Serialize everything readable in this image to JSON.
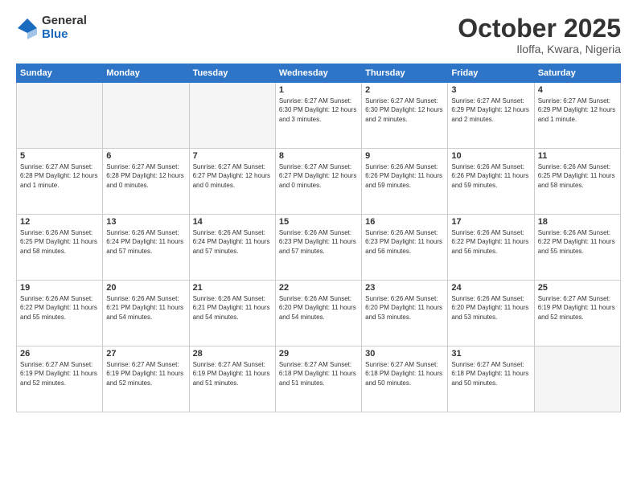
{
  "logo": {
    "general": "General",
    "blue": "Blue"
  },
  "header": {
    "month": "October 2025",
    "location": "Iloffa, Kwara, Nigeria"
  },
  "days_of_week": [
    "Sunday",
    "Monday",
    "Tuesday",
    "Wednesday",
    "Thursday",
    "Friday",
    "Saturday"
  ],
  "weeks": [
    [
      {
        "day": "",
        "info": ""
      },
      {
        "day": "",
        "info": ""
      },
      {
        "day": "",
        "info": ""
      },
      {
        "day": "1",
        "info": "Sunrise: 6:27 AM\nSunset: 6:30 PM\nDaylight: 12 hours\nand 3 minutes."
      },
      {
        "day": "2",
        "info": "Sunrise: 6:27 AM\nSunset: 6:30 PM\nDaylight: 12 hours\nand 2 minutes."
      },
      {
        "day": "3",
        "info": "Sunrise: 6:27 AM\nSunset: 6:29 PM\nDaylight: 12 hours\nand 2 minutes."
      },
      {
        "day": "4",
        "info": "Sunrise: 6:27 AM\nSunset: 6:29 PM\nDaylight: 12 hours\nand 1 minute."
      }
    ],
    [
      {
        "day": "5",
        "info": "Sunrise: 6:27 AM\nSunset: 6:28 PM\nDaylight: 12 hours\nand 1 minute."
      },
      {
        "day": "6",
        "info": "Sunrise: 6:27 AM\nSunset: 6:28 PM\nDaylight: 12 hours\nand 0 minutes."
      },
      {
        "day": "7",
        "info": "Sunrise: 6:27 AM\nSunset: 6:27 PM\nDaylight: 12 hours\nand 0 minutes."
      },
      {
        "day": "8",
        "info": "Sunrise: 6:27 AM\nSunset: 6:27 PM\nDaylight: 12 hours\nand 0 minutes."
      },
      {
        "day": "9",
        "info": "Sunrise: 6:26 AM\nSunset: 6:26 PM\nDaylight: 11 hours\nand 59 minutes."
      },
      {
        "day": "10",
        "info": "Sunrise: 6:26 AM\nSunset: 6:26 PM\nDaylight: 11 hours\nand 59 minutes."
      },
      {
        "day": "11",
        "info": "Sunrise: 6:26 AM\nSunset: 6:25 PM\nDaylight: 11 hours\nand 58 minutes."
      }
    ],
    [
      {
        "day": "12",
        "info": "Sunrise: 6:26 AM\nSunset: 6:25 PM\nDaylight: 11 hours\nand 58 minutes."
      },
      {
        "day": "13",
        "info": "Sunrise: 6:26 AM\nSunset: 6:24 PM\nDaylight: 11 hours\nand 57 minutes."
      },
      {
        "day": "14",
        "info": "Sunrise: 6:26 AM\nSunset: 6:24 PM\nDaylight: 11 hours\nand 57 minutes."
      },
      {
        "day": "15",
        "info": "Sunrise: 6:26 AM\nSunset: 6:23 PM\nDaylight: 11 hours\nand 57 minutes."
      },
      {
        "day": "16",
        "info": "Sunrise: 6:26 AM\nSunset: 6:23 PM\nDaylight: 11 hours\nand 56 minutes."
      },
      {
        "day": "17",
        "info": "Sunrise: 6:26 AM\nSunset: 6:22 PM\nDaylight: 11 hours\nand 56 minutes."
      },
      {
        "day": "18",
        "info": "Sunrise: 6:26 AM\nSunset: 6:22 PM\nDaylight: 11 hours\nand 55 minutes."
      }
    ],
    [
      {
        "day": "19",
        "info": "Sunrise: 6:26 AM\nSunset: 6:22 PM\nDaylight: 11 hours\nand 55 minutes."
      },
      {
        "day": "20",
        "info": "Sunrise: 6:26 AM\nSunset: 6:21 PM\nDaylight: 11 hours\nand 54 minutes."
      },
      {
        "day": "21",
        "info": "Sunrise: 6:26 AM\nSunset: 6:21 PM\nDaylight: 11 hours\nand 54 minutes."
      },
      {
        "day": "22",
        "info": "Sunrise: 6:26 AM\nSunset: 6:20 PM\nDaylight: 11 hours\nand 54 minutes."
      },
      {
        "day": "23",
        "info": "Sunrise: 6:26 AM\nSunset: 6:20 PM\nDaylight: 11 hours\nand 53 minutes."
      },
      {
        "day": "24",
        "info": "Sunrise: 6:26 AM\nSunset: 6:20 PM\nDaylight: 11 hours\nand 53 minutes."
      },
      {
        "day": "25",
        "info": "Sunrise: 6:27 AM\nSunset: 6:19 PM\nDaylight: 11 hours\nand 52 minutes."
      }
    ],
    [
      {
        "day": "26",
        "info": "Sunrise: 6:27 AM\nSunset: 6:19 PM\nDaylight: 11 hours\nand 52 minutes."
      },
      {
        "day": "27",
        "info": "Sunrise: 6:27 AM\nSunset: 6:19 PM\nDaylight: 11 hours\nand 52 minutes."
      },
      {
        "day": "28",
        "info": "Sunrise: 6:27 AM\nSunset: 6:19 PM\nDaylight: 11 hours\nand 51 minutes."
      },
      {
        "day": "29",
        "info": "Sunrise: 6:27 AM\nSunset: 6:18 PM\nDaylight: 11 hours\nand 51 minutes."
      },
      {
        "day": "30",
        "info": "Sunrise: 6:27 AM\nSunset: 6:18 PM\nDaylight: 11 hours\nand 50 minutes."
      },
      {
        "day": "31",
        "info": "Sunrise: 6:27 AM\nSunset: 6:18 PM\nDaylight: 11 hours\nand 50 minutes."
      },
      {
        "day": "",
        "info": ""
      }
    ]
  ]
}
